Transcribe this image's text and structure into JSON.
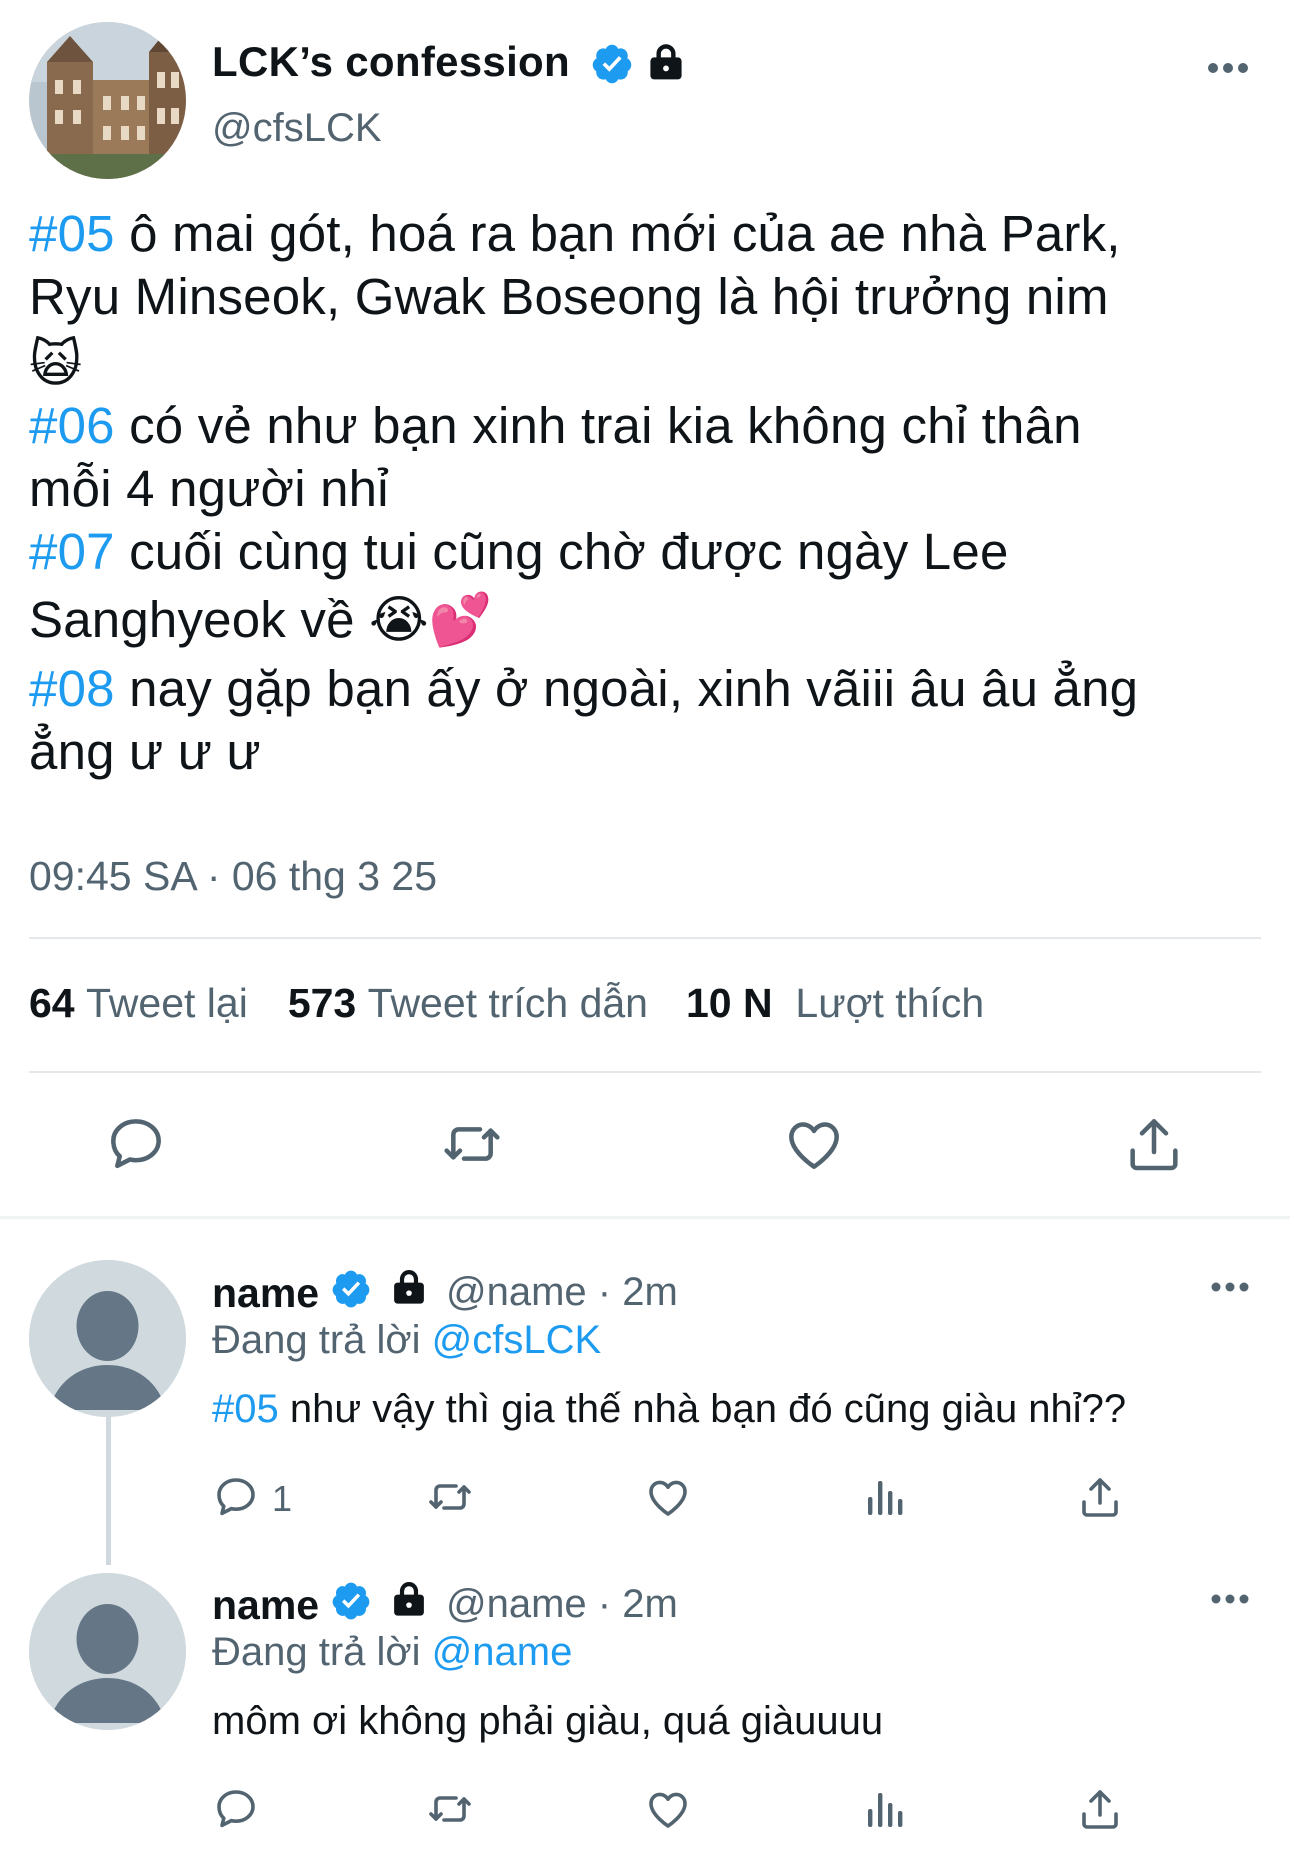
{
  "main_tweet": {
    "author_name": "LCK’s confession",
    "author_handle": "@cfsLCK",
    "avatar_icon": "building-photo-avatar",
    "verified_icon": "verified-badge-icon",
    "lock_icon": "lock-icon",
    "more_icon": "more-icon",
    "lines": [
      {
        "tag": "#05",
        "text": " ô mai gót, hoá ra bạn mới của ae nhà Park,"
      },
      {
        "tag": "",
        "text": "Ryu Minseok, Gwak Boseong là hội trưởng nim"
      },
      {
        "emoji": "🙀"
      },
      {
        "tag": "#06",
        "text": " có vẻ như bạn xinh trai kia không chỉ thân"
      },
      {
        "tag": "",
        "text": "mỗi 4 người nhỉ"
      },
      {
        "tag": "#07",
        "text": " cuối cùng tui cũng chờ được ngày Lee"
      },
      {
        "tag": "",
        "text": "Sanghyeok về ",
        "emoji_after": "😭💕"
      },
      {
        "tag": "#08",
        "text": " nay gặp bạn ấy ở ngoài, xinh vãiii âu âu ẳng"
      },
      {
        "tag": "",
        "text": "ẳng ư ư ư"
      }
    ],
    "timestamp": "09:45 SA · 06 thg 3 25",
    "stats": {
      "retweets_count": "64",
      "retweets_label": "Tweet lại",
      "quotes_count": "573",
      "quotes_label": "Tweet trích dẫn",
      "likes_count": "10 N",
      "likes_label": "Lượt thích"
    },
    "actions": [
      "reply-icon",
      "retweet-icon",
      "like-icon",
      "share-icon"
    ]
  },
  "replies": [
    {
      "name": "name",
      "handle_time": "@name · 2m",
      "replying_prefix": "Đang trả lời ",
      "replying_to": "@cfsLCK",
      "tag": "#05",
      "text": " như vậy thì gia thế nhà bạn đó cũng giàu nhỉ??",
      "reply_count": "1"
    },
    {
      "name": "name",
      "handle_time": "@name · 2m",
      "replying_prefix": "Đang trả lời ",
      "replying_to": "@name",
      "tag": "",
      "text": "môm ơi không phải giàu, quá giàuuuu",
      "reply_count": ""
    }
  ],
  "colors": {
    "accent": "#1d9bf0",
    "text": "#0f1419",
    "secondary": "#536471",
    "divider": "#e4e8eb"
  }
}
